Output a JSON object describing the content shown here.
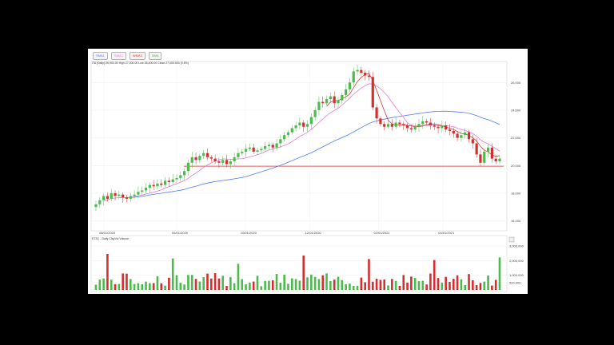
{
  "legend": {
    "items": [
      {
        "label": "SMA1",
        "color": "#4f7cff"
      },
      {
        "label": "SMA2",
        "color": "#e57bd6"
      },
      {
        "label": "WMA3",
        "color": "#d63a3a"
      },
      {
        "label": "SMA",
        "color": "#58a052"
      }
    ]
  },
  "quote": {
    "text": "ITA (Daily)  26,900.00  High 27,000.00  Low 26,400.00  Close 27,000.000 (0.5%)"
  },
  "volume": {
    "label": "ETSC - Daily Chg/Vol Volume"
  },
  "chart_data": {
    "type": "candlestick",
    "y_ticks": [
      "26,000",
      "24,000",
      "22,000",
      "20,000",
      "18,000",
      "16,000"
    ],
    "x_ticks": [
      "08/01/2020",
      "09/01/2020",
      "10/01/2020",
      "12/01/2020",
      "02/01/2021",
      "04/01/2021"
    ],
    "ylim": [
      15400,
      27400
    ],
    "support_level": 19950,
    "volume_ticks": [
      "3,000,000",
      "2,000,000",
      "1,000,000",
      "500,000"
    ],
    "colors": {
      "up": "#4cbb4c",
      "down": "#d42f2f",
      "sma1": "#4f7cff",
      "sma2": "#e57bd6",
      "wma3": "#d63a3a",
      "support": "#d63a3a"
    },
    "close": [
      17200,
      17500,
      17800,
      17600,
      18000,
      17800,
      17900,
      17700,
      17600,
      17800,
      17900,
      18100,
      18200,
      18400,
      18600,
      18500,
      18700,
      18600,
      18900,
      18800,
      19000,
      19100,
      19300,
      19600,
      20200,
      20600,
      20400,
      20700,
      20900,
      20600,
      20500,
      20300,
      20200,
      20400,
      20100,
      20300,
      20600,
      20900,
      21000,
      21200,
      21300,
      21000,
      21100,
      21200,
      21400,
      21500,
      21300,
      21600,
      21900,
      22200,
      22400,
      22700,
      22900,
      23100,
      22800,
      23000,
      23500,
      24000,
      24600,
      24500,
      24800,
      25000,
      24500,
      24700,
      25100,
      25500,
      26000,
      26800,
      26900,
      26700,
      26500,
      26400,
      24200,
      23400,
      23000,
      22800,
      23000,
      22800,
      23100,
      23000,
      22900,
      22700,
      22600,
      22800,
      23000,
      23200,
      23100,
      22900,
      22800,
      22700,
      22900,
      22600,
      22500,
      22300,
      22000,
      22200,
      22400,
      21900,
      21600,
      20800,
      20200,
      21000,
      21300,
      20500,
      20300,
      20500
    ]
  }
}
